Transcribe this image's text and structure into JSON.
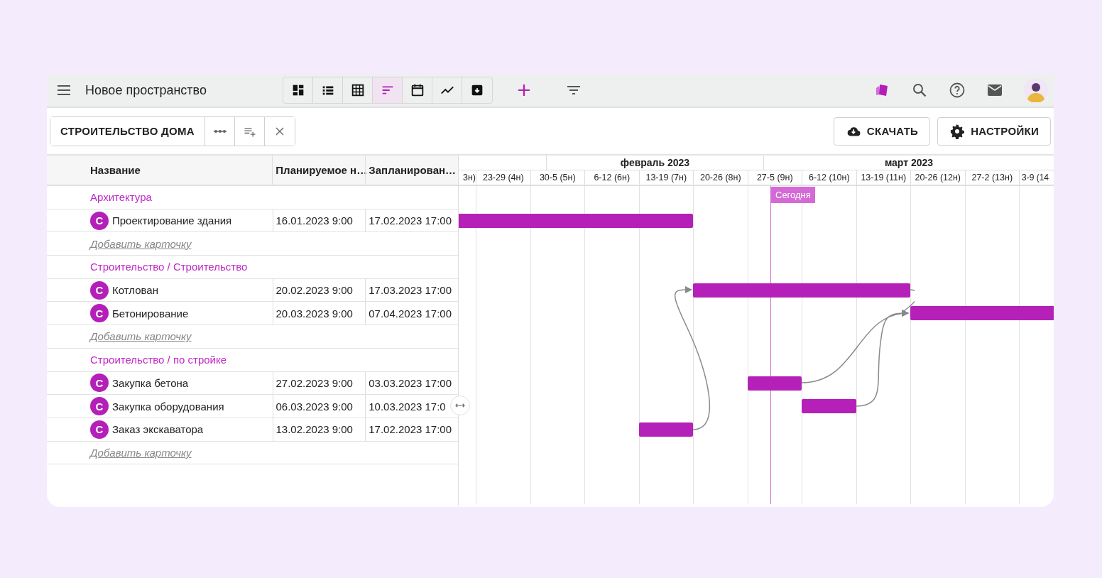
{
  "toolbar": {
    "title": "Новое пространство",
    "views": [
      {
        "kind": "dashboard",
        "selected": false
      },
      {
        "kind": "list",
        "selected": false
      },
      {
        "kind": "table",
        "selected": false
      },
      {
        "kind": "gantt",
        "selected": true
      },
      {
        "kind": "calendar",
        "selected": false
      },
      {
        "kind": "chart",
        "selected": false
      },
      {
        "kind": "archive",
        "selected": false
      }
    ]
  },
  "board_bar": {
    "name": "СТРОИТЕЛЬСТВО ДОМА",
    "actions": [
      {
        "kind": "download",
        "label": "СКАЧАТЬ"
      },
      {
        "kind": "settings",
        "label": "НАСТРОЙКИ"
      }
    ]
  },
  "table": {
    "columns": [
      "Название",
      "Планируемое н…",
      "Запланирован…"
    ],
    "groups": [
      {
        "title": "Архитектура",
        "add_label": "Добавить карточку",
        "tasks": [
          {
            "badge": "С",
            "name": "Проектирование здания",
            "start": "16.01.2023 9:00",
            "end": "17.02.2023 17:00"
          }
        ]
      },
      {
        "title": "Строительство / Строительство",
        "add_label": "Добавить карточку",
        "tasks": [
          {
            "badge": "С",
            "name": "Котлован",
            "start": "20.02.2023 9:00",
            "end": "17.03.2023 17:00"
          },
          {
            "badge": "С",
            "name": "Бетонирование",
            "start": "20.03.2023 9:00",
            "end": "07.04.2023 17:00"
          }
        ]
      },
      {
        "title": "Строительство / по стройке",
        "add_label": "Добавить карточку",
        "tasks": [
          {
            "badge": "С",
            "name": "Закупка бетона",
            "start": "27.02.2023 9:00",
            "end": "03.03.2023 17:00"
          },
          {
            "badge": "С",
            "name": "Закупка оборудования",
            "start": "06.03.2023 9:00",
            "end": "10.03.2023 17:0"
          },
          {
            "badge": "С",
            "name": "Заказ экскаватора",
            "start": "13.02.2023 9:00",
            "end": "17.02.2023 17:00"
          }
        ]
      }
    ]
  },
  "timeline": {
    "months": [
      "февраль 2023",
      "март 2023"
    ],
    "weeks": [
      "3н)",
      "23-29 (4н)",
      "30-5 (5н)",
      "6-12 (6н)",
      "13-19 (7н)",
      "20-26 (8н)",
      "27-5 (9н)",
      "6-12 (10н)",
      "13-19 (11н)",
      "20-26 (12н)",
      "27-2 (13н)",
      "3-9 (14"
    ],
    "today_label": "Сегодня"
  }
}
